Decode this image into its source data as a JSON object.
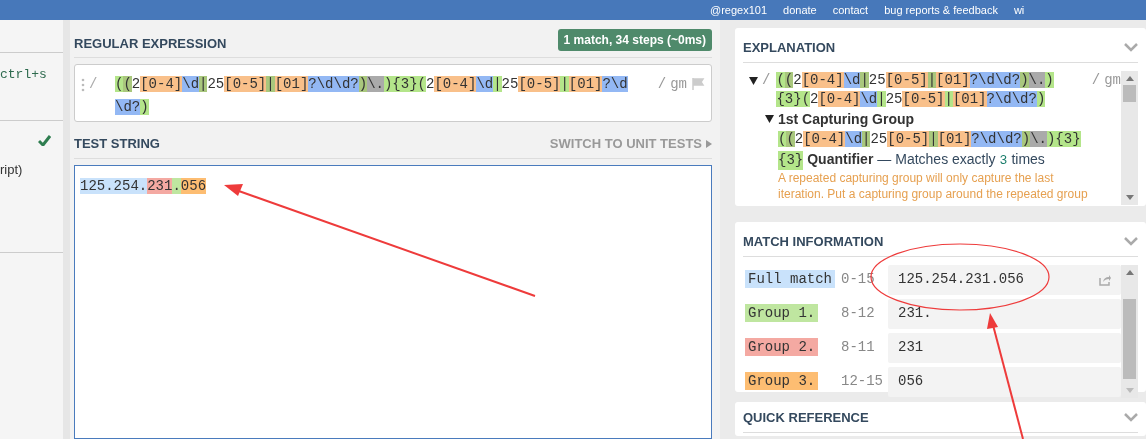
{
  "top_nav": {
    "links": [
      {
        "label": "@regex101"
      },
      {
        "label": "donate"
      },
      {
        "label": "contact"
      },
      {
        "label": "bug reports & feedback"
      },
      {
        "label": "wi"
      }
    ]
  },
  "sidebar": {
    "shortcut": "ctrl+s",
    "item_checked": true,
    "item_text": "ript)"
  },
  "regex_panel": {
    "title": "REGULAR EXPRESSION",
    "badge": "1 match, 34 steps (~0ms)",
    "delimiter_open": "/",
    "delimiter_close": "/",
    "flags": "gm",
    "tokens": [
      {
        "text": "(",
        "color": "#b4e58a"
      },
      {
        "text": "(",
        "color": "#a9c77d"
      },
      {
        "text": "2"
      },
      {
        "text": "[0-4]",
        "color": "#f9c08a"
      },
      {
        "text": "\\d",
        "color": "#93b8f4"
      },
      {
        "text": "|",
        "color": "#a9c77d"
      },
      {
        "text": "25"
      },
      {
        "text": "[0-5]",
        "color": "#f9c08a"
      },
      {
        "text": "|",
        "color": "#a9c77d"
      },
      {
        "text": "[01]",
        "color": "#f9c08a"
      },
      {
        "text": "?\\d\\d?",
        "color": "#93b8f4"
      },
      {
        "text": ")",
        "color": "#a9c77d"
      },
      {
        "text": "\\.",
        "color": "#aaaaaa"
      },
      {
        "text": ")",
        "color": "#b4e58a"
      },
      {
        "text": "{3}",
        "color": "#b4e58a"
      },
      {
        "text": "(",
        "color": "#b4e58a"
      },
      {
        "text": "2"
      },
      {
        "text": "[0-4]",
        "color": "#f9c08a"
      },
      {
        "text": "\\d",
        "color": "#93b8f4"
      },
      {
        "text": "|",
        "color": "#b4e58a"
      },
      {
        "text": "25"
      },
      {
        "text": "[0-5]",
        "color": "#f9c08a"
      },
      {
        "text": "|",
        "color": "#b4e58a"
      },
      {
        "text": "[01]",
        "color": "#f9c08a"
      },
      {
        "text": "?\\d\\d?",
        "color": "#93b8f4"
      },
      {
        "text": ")",
        "color": "#b4e58a"
      }
    ]
  },
  "test_panel": {
    "title": "TEST STRING",
    "switch_link": "SWITCH TO UNIT TESTS",
    "highlights": [
      {
        "text": "125.254.",
        "color": "#c9e2fb"
      },
      {
        "text": "231",
        "color": "#f4a9a2"
      },
      {
        "text": ".",
        "color": "#bfe6a0"
      },
      {
        "text": "056",
        "color": "#fdbd72"
      }
    ]
  },
  "explanation": {
    "title": "EXPLANATION",
    "delimiter_open": "/",
    "delimiter_close": "/",
    "flags": "gm",
    "tokens": [
      {
        "text": "(",
        "color": "#b4e58a"
      },
      {
        "text": "(",
        "color": "#a9c77d"
      },
      {
        "text": "2"
      },
      {
        "text": "[0-4]",
        "color": "#f9c08a"
      },
      {
        "text": "\\d",
        "color": "#93b8f4"
      },
      {
        "text": "|",
        "color": "#a9c77d"
      },
      {
        "text": "25"
      },
      {
        "text": "[0-5]",
        "color": "#f9c08a"
      },
      {
        "text": "|",
        "color": "#a9c77d"
      },
      {
        "text": "[01]",
        "color": "#f9c08a"
      },
      {
        "text": "?\\d\\d?",
        "color": "#93b8f4"
      },
      {
        "text": ")",
        "color": "#a9c77d"
      },
      {
        "text": "\\.",
        "color": "#aaaaaa"
      },
      {
        "text": ")",
        "color": "#b4e58a"
      },
      {
        "text": "{3}",
        "color": "#b4e58a"
      },
      {
        "text": "(",
        "color": "#b4e58a"
      },
      {
        "text": "2"
      },
      {
        "text": "[0-4]",
        "color": "#f9c08a"
      },
      {
        "text": "\\d",
        "color": "#93b8f4"
      },
      {
        "text": "|",
        "color": "#b4e58a"
      },
      {
        "text": "25"
      },
      {
        "text": "[0-5]",
        "color": "#f9c08a"
      },
      {
        "text": "|",
        "color": "#b4e58a"
      },
      {
        "text": "[01]",
        "color": "#f9c08a"
      },
      {
        "text": "?\\d\\d?",
        "color": "#93b8f4"
      },
      {
        "text": ")",
        "color": "#b4e58a"
      }
    ],
    "group": {
      "title": "1st Capturing Group",
      "expanded": true,
      "tokens": [
        {
          "text": "(",
          "color": "#b4e58a"
        },
        {
          "text": "(",
          "color": "#a9c77d"
        },
        {
          "text": "2"
        },
        {
          "text": "[0-4]",
          "color": "#f9c08a"
        },
        {
          "text": "\\d",
          "color": "#93b8f4"
        },
        {
          "text": "|",
          "color": "#a9c77d"
        },
        {
          "text": "25"
        },
        {
          "text": "[0-5]",
          "color": "#f9c08a"
        },
        {
          "text": "|",
          "color": "#a9c77d"
        },
        {
          "text": "[01]",
          "color": "#f9c08a"
        },
        {
          "text": "?\\d\\d?",
          "color": "#93b8f4"
        },
        {
          "text": ")",
          "color": "#a9c77d"
        },
        {
          "text": "\\.",
          "color": "#aaaaaa"
        },
        {
          "text": ")",
          "color": "#b4e58a"
        },
        {
          "text": "{3}",
          "color": "#b4e58a"
        }
      ]
    },
    "quantifier": {
      "token": {
        "text": "{3}",
        "color": "#b4e58a"
      },
      "title": "Quantifier",
      "text": "— Matches exactly",
      "count": "3",
      "suffix": "times"
    },
    "note": "A repeated capturing group will only capture the last iteration. Put a capturing group around the repeated group"
  },
  "match_information": {
    "title": "MATCH INFORMATION",
    "rows": [
      {
        "label": "Full match",
        "color": "#c9e2fb",
        "range": "0-15",
        "value": "125.254.231.056"
      },
      {
        "label": "Group 1.",
        "color": "#bfe6a0",
        "range": "8-12",
        "value": "231."
      },
      {
        "label": "Group 2.",
        "color": "#f4a9a2",
        "range": "8-11",
        "value": "231"
      },
      {
        "label": "Group 3.",
        "color": "#fdbd72",
        "range": "12-15",
        "value": "056"
      }
    ]
  },
  "quick_reference": {
    "title": "QUICK REFERENCE"
  }
}
